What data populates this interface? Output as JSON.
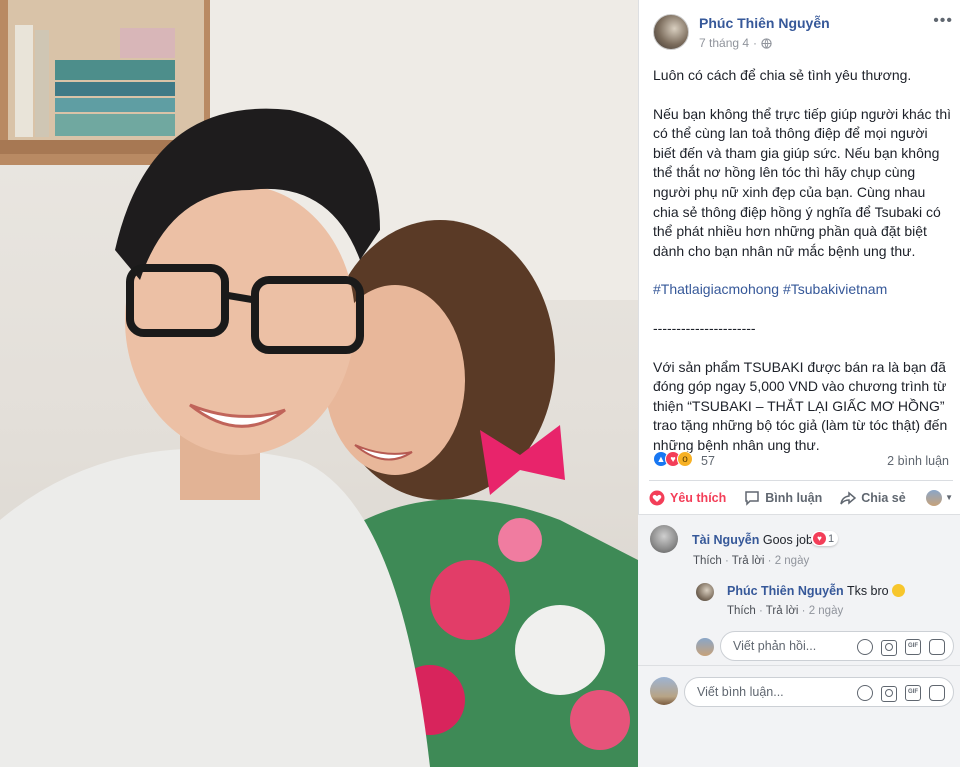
{
  "photo": {
    "alt": ""
  },
  "post": {
    "author": "Phúc Thiên Nguyễn",
    "date": "7 tháng 4",
    "more_icon": "more-options-icon",
    "paragraphs": [
      "Luôn có cách để chia sẻ tình yêu thương.",
      "Nếu bạn không thể trực tiếp giúp người khác thì có thể cùng lan toả thông điệp để mọi người biết đến và tham gia giúp sức. Nếu bạn không thể thắt nơ hồng lên tóc thì hãy chụp cùng người phụ nữ xinh đẹp của bạn. Cùng nhau chia sẻ thông điệp hồng ý nghĩa để Tsubaki có thể phát nhiều hơn những phần quà đặt biệt dành cho bạn nhân nữ mắc bệnh ung thư.",
      "#Thatlaigiacmohong #Tsubakivietnam",
      "----------------------",
      "Với sản phẩm TSUBAKI được bán ra là bạn đã đóng góp ngay 5,000 VND vào chương trình từ thiện “TSUBAKI – THẮT LẠI GIẤC MƠ HỒNG” trao tặng những bộ tóc giả (làm từ tóc thật) đến những bệnh nhân ung thư."
    ]
  },
  "stats": {
    "reactions": "57",
    "comments": "2 bình luận"
  },
  "actions": {
    "like": "Yêu thích",
    "comment": "Bình luận",
    "share": "Chia sẻ"
  },
  "comments": [
    {
      "name": "Tài Nguyễn",
      "text": "Goos job",
      "react_count": "1",
      "like": "Thích",
      "reply": "Trả lời",
      "time": "2 ngày"
    },
    {
      "name": "Phúc Thiên Nguyễn",
      "text": "Tks bro",
      "like": "Thích",
      "reply": "Trả lời",
      "time": "2 ngày"
    }
  ],
  "reply_input": {
    "placeholder": "Viết phản hồi..."
  },
  "comment_input": {
    "placeholder": "Viết bình luận..."
  },
  "colors": {
    "link": "#365899",
    "love": "#f33e58",
    "like": "#1877f2",
    "muted": "#90949c"
  }
}
